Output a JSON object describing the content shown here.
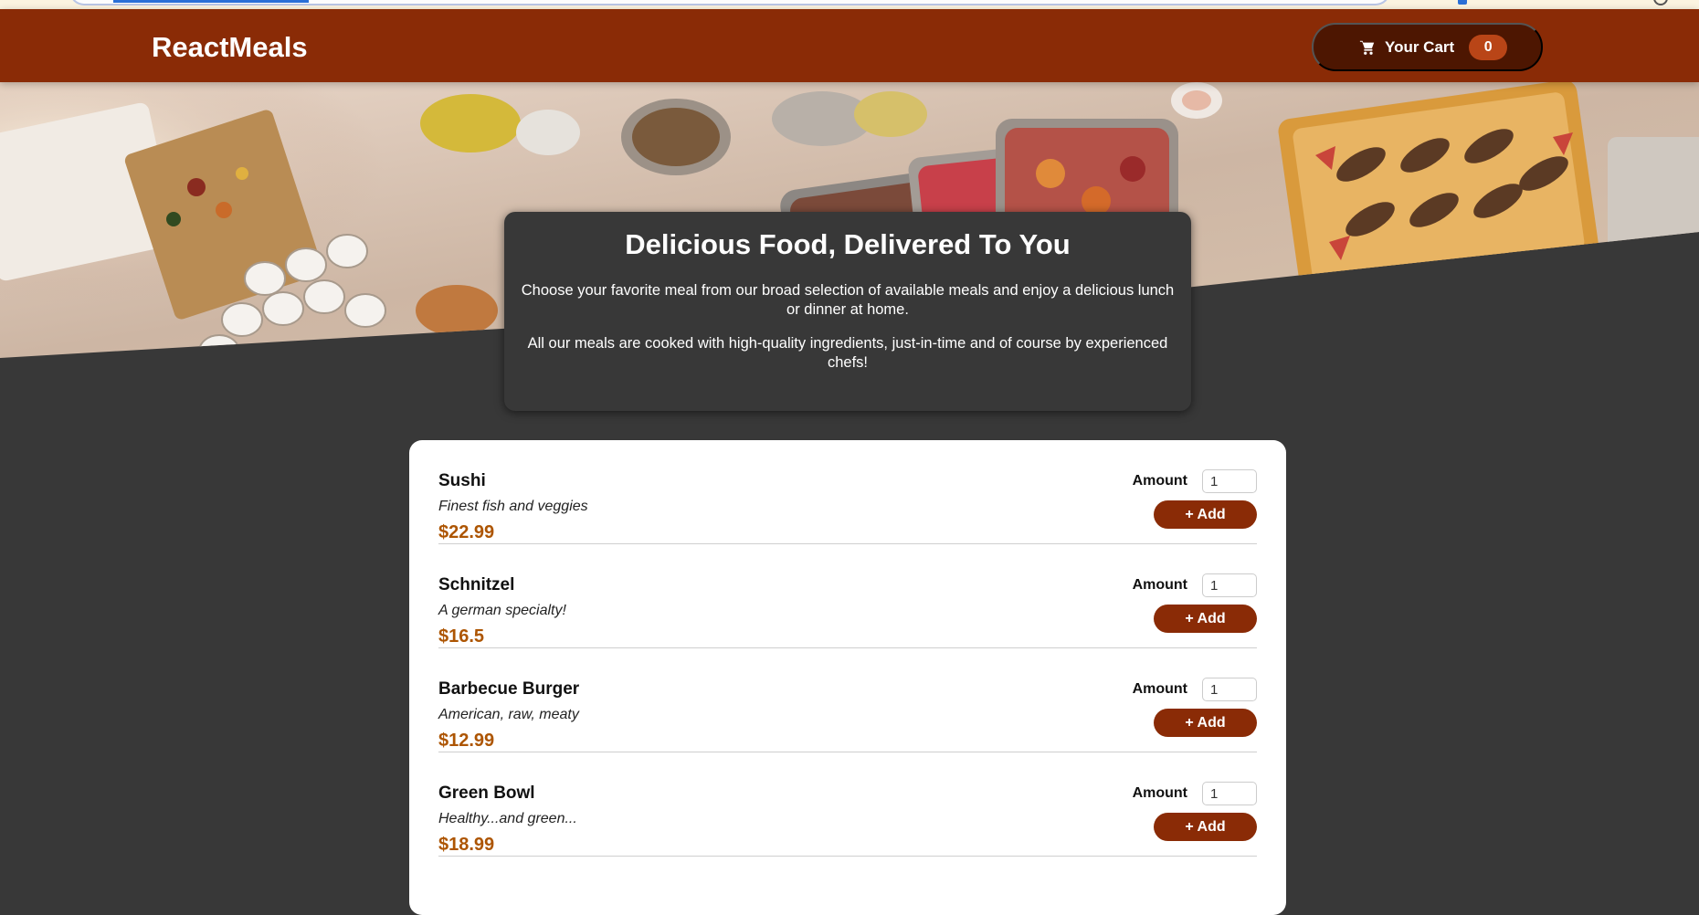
{
  "header": {
    "logo": "ReactMeals",
    "cart": {
      "label": "Your Cart",
      "count": "0",
      "icon": "cart-icon"
    }
  },
  "summary": {
    "title": "Delicious Food, Delivered To You",
    "paragraph1": "Choose your favorite meal from our broad selection of available meals and enjoy a delicious lunch or dinner at home.",
    "paragraph2": "All our meals are cooked with high-quality ingredients, just-in-time and of course by experienced chefs!"
  },
  "meals": [
    {
      "name": "Sushi",
      "description": "Finest fish and veggies",
      "price": "$22.99",
      "amount_label": "Amount",
      "amount": "1",
      "add_label": "+ Add"
    },
    {
      "name": "Schnitzel",
      "description": "A german specialty!",
      "price": "$16.5",
      "amount_label": "Amount",
      "amount": "1",
      "add_label": "+ Add"
    },
    {
      "name": "Barbecue Burger",
      "description": "American, raw, meaty",
      "price": "$12.99",
      "amount_label": "Amount",
      "amount": "1",
      "add_label": "+ Add"
    },
    {
      "name": "Green Bowl",
      "description": "Healthy...and green...",
      "price": "$18.99",
      "amount_label": "Amount",
      "amount": "1",
      "add_label": "+ Add"
    }
  ],
  "colors": {
    "header": "#8a2b06",
    "cart_button": "#4d1601",
    "badge": "#b94517",
    "background": "#383838",
    "price": "#ad5502"
  }
}
